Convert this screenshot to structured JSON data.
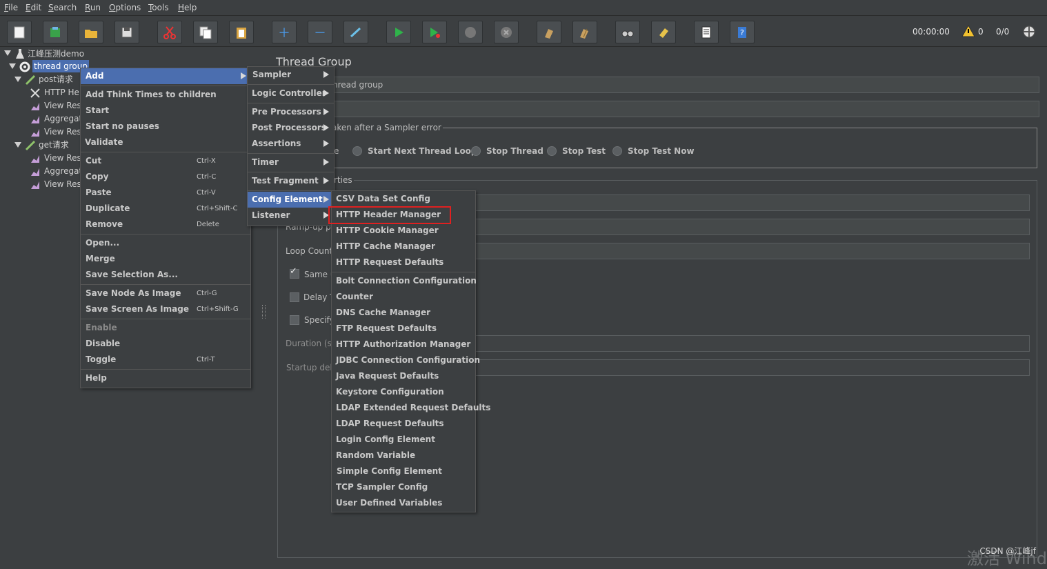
{
  "menubar": {
    "items": [
      "File",
      "Edit",
      "Search",
      "Run",
      "Options",
      "Tools",
      "Help"
    ]
  },
  "toolbar": {
    "icons": [
      "new-icon",
      "templates-icon",
      "open-icon",
      "save-icon",
      "cut-icon",
      "copy-icon",
      "paste-icon",
      "expand-icon",
      "collapse-icon",
      "toggle-icon",
      "start-icon",
      "start-no-pauses-icon",
      "stop-icon",
      "shutdown-icon",
      "clear-icon",
      "clear-all-icon",
      "search-icon",
      "reset-search-icon",
      "function-helper-icon",
      "help-icon"
    ],
    "timer": "00:00:00",
    "warning_count": "0",
    "threads": "0/0"
  },
  "tree": {
    "root": "江峰压测demo",
    "thread_group": "thread group",
    "post": "post请求",
    "post_children": [
      "HTTP He",
      "View Res",
      "Aggregat",
      "View Res"
    ],
    "get": "get请求",
    "get_children": [
      "View Res",
      "Aggregat",
      "View Res"
    ]
  },
  "panel": {
    "title": "Thread Group",
    "name_value": "hread group",
    "action_legend": "aken after a Sampler error",
    "action_partial": "e",
    "actions": [
      "Start Next Thread Loop",
      "Stop Thread",
      "Stop Test",
      "Stop Test Now"
    ],
    "properties_legend": "rties",
    "rampup": "Ramp-up pe",
    "loop": "Loop Count:",
    "same": "Same u",
    "delay": "Delay T",
    "specify": "Specify",
    "duration": "Duration (se",
    "startup": "Startup dela"
  },
  "context_menu": {
    "add": "Add",
    "items": [
      {
        "label": "Add Think Times to children",
        "shortcut": ""
      },
      {
        "label": "Start",
        "shortcut": ""
      },
      {
        "label": "Start no pauses",
        "shortcut": ""
      },
      {
        "label": "Validate",
        "shortcut": ""
      },
      {
        "label": "Cut",
        "shortcut": "Ctrl-X"
      },
      {
        "label": "Copy",
        "shortcut": "Ctrl-C"
      },
      {
        "label": "Paste",
        "shortcut": "Ctrl-V"
      },
      {
        "label": "Duplicate",
        "shortcut": "Ctrl+Shift-C"
      },
      {
        "label": "Remove",
        "shortcut": "Delete"
      },
      {
        "label": "Open...",
        "shortcut": ""
      },
      {
        "label": "Merge",
        "shortcut": ""
      },
      {
        "label": "Save Selection As...",
        "shortcut": ""
      },
      {
        "label": "Save Node As Image",
        "shortcut": "Ctrl-G"
      },
      {
        "label": "Save Screen As Image",
        "shortcut": "Ctrl+Shift-G"
      },
      {
        "label": "Enable",
        "shortcut": ""
      },
      {
        "label": "Disable",
        "shortcut": ""
      },
      {
        "label": "Toggle",
        "shortcut": "Ctrl-T"
      },
      {
        "label": "Help",
        "shortcut": ""
      }
    ]
  },
  "add_menu": {
    "items": [
      "Sampler",
      "Logic Controller",
      "Pre Processors",
      "Post Processors",
      "Assertions",
      "Timer",
      "Test Fragment",
      "Config Element",
      "Listener"
    ]
  },
  "config_menu": {
    "items": [
      "CSV Data Set Config",
      "HTTP Header Manager",
      "HTTP Cookie Manager",
      "HTTP Cache Manager",
      "HTTP Request Defaults",
      "Bolt Connection Configuration",
      "Counter",
      "DNS Cache Manager",
      "FTP Request Defaults",
      "HTTP Authorization Manager",
      "JDBC Connection Configuration",
      "Java Request Defaults",
      "Keystore Configuration",
      "LDAP Extended Request Defaults",
      "LDAP Request Defaults",
      "Login Config Element",
      "Random Variable",
      "Simple Config Element",
      "TCP Sampler Config",
      "User Defined Variables"
    ]
  },
  "watermark": "CSDN @江峰jf",
  "activate_text": "激活 Wind",
  "colors": {
    "background": "#3c3f41",
    "selection": "#4b6eaf",
    "highlight_box": "#e02020"
  }
}
